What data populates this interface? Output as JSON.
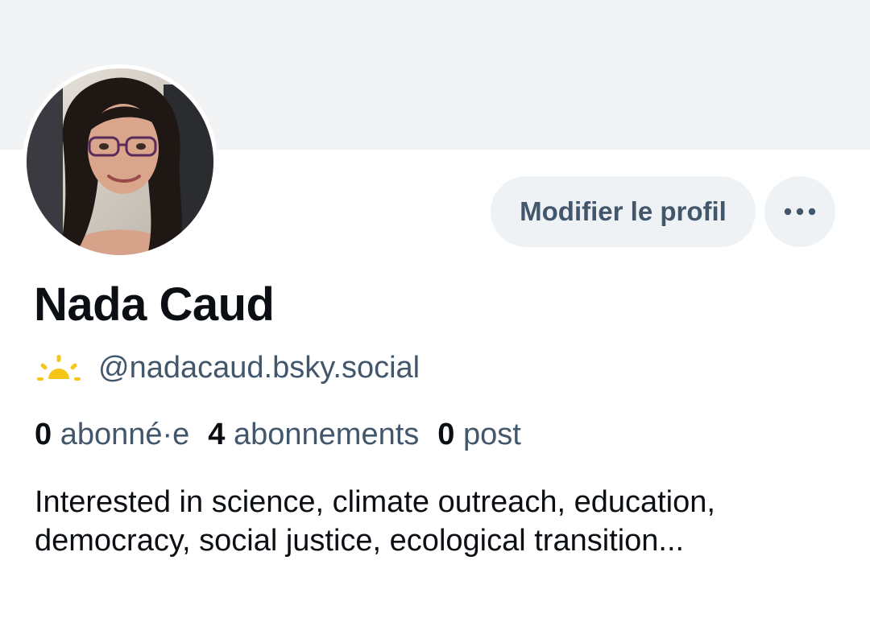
{
  "profile": {
    "display_name": "Nada Caud",
    "handle": "@nadacaud.bsky.social",
    "handle_icon": "sunrise-icon",
    "bio": "Interested in science, climate outreach, education, democracy, social justice, ecological transition...",
    "stats": {
      "followers_count": "0",
      "followers_label": "abonné·e",
      "following_count": "4",
      "following_label": "abonnements",
      "posts_count": "0",
      "posts_label": "post"
    }
  },
  "actions": {
    "edit_profile_label": "Modifier le profil",
    "more_icon": "more-horizontal-icon"
  },
  "colors": {
    "banner": "#f1f3f5",
    "button_bg": "#eff2f5",
    "secondary_text": "#42576c",
    "primary_text": "#0b0f14",
    "sun_icon": "#f5c518"
  }
}
